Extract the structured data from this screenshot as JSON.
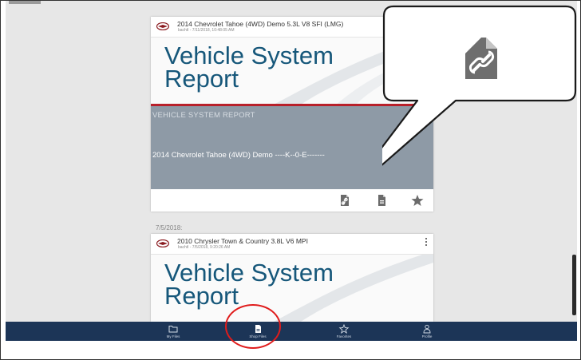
{
  "colors": {
    "nav_background": "#1c3557",
    "report_title": "#16577a",
    "report_band": "#8e9aa6",
    "accent_red": "#b8202a",
    "highlight": "#e01b1b"
  },
  "cards": [
    {
      "title": "2014 Chevrolet Tahoe (4WD) Demo 5.3L V8 SFI (LMG)",
      "subtitle": "bachtl - 7/11/2018, 10:48:05 AM",
      "thumb_title_line1": "Vehicle System",
      "thumb_title_line2": "Report",
      "band_label": "VEHICLE SYSTEM REPORT",
      "band_vehicle": "2014  Chevrolet  Tahoe  (4WD)  Demo  ----K--0-E-------",
      "actions": [
        "share-link-icon",
        "shop-file-icon",
        "favorite-star-icon"
      ]
    },
    {
      "date": "7/5/2018:",
      "title": "2010 Chrysler Town & Country 3.8L V6 MPI",
      "subtitle": "bachtl - 7/5/2018, 9:20:26 AM",
      "thumb_title_line1": "Vehicle System",
      "thumb_title_line2": "Report"
    }
  ],
  "callout": {
    "icon": "share-link-icon"
  },
  "bottom_nav": [
    {
      "label": "My Files",
      "icon": "folder-icon"
    },
    {
      "label": "Shop Files",
      "icon": "shop-file-icon",
      "highlighted": true
    },
    {
      "label": "Favorites",
      "icon": "star-icon"
    },
    {
      "label": "Profile",
      "icon": "profile-icon"
    }
  ]
}
